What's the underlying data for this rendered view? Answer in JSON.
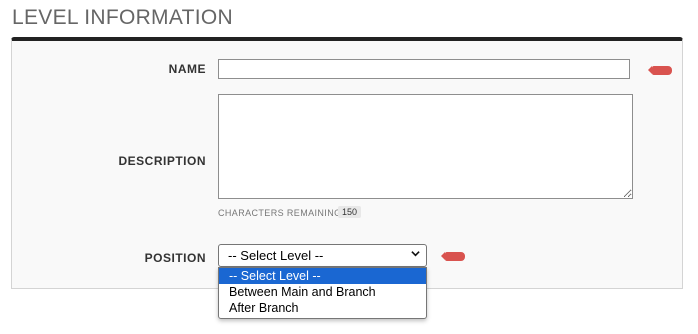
{
  "page": {
    "title": "LEVEL INFORMATION"
  },
  "form": {
    "name": {
      "label": "NAME",
      "value": ""
    },
    "description": {
      "label": "DESCRIPTION",
      "value": ""
    },
    "characters_remaining": {
      "label": "CHARACTERS REMAINING",
      "count": "150"
    },
    "position": {
      "label": "POSITION",
      "selected": "-- Select Level --",
      "options": [
        "-- Select Level --",
        "Between Main and Branch",
        "After Branch"
      ]
    }
  },
  "colors": {
    "required_marker": "#d9534f",
    "panel_border_top": "#222222",
    "option_highlight": "#1a67d2"
  },
  "icons": {
    "required": "required-marker-icon",
    "dropdown": "chevron-down-icon"
  }
}
